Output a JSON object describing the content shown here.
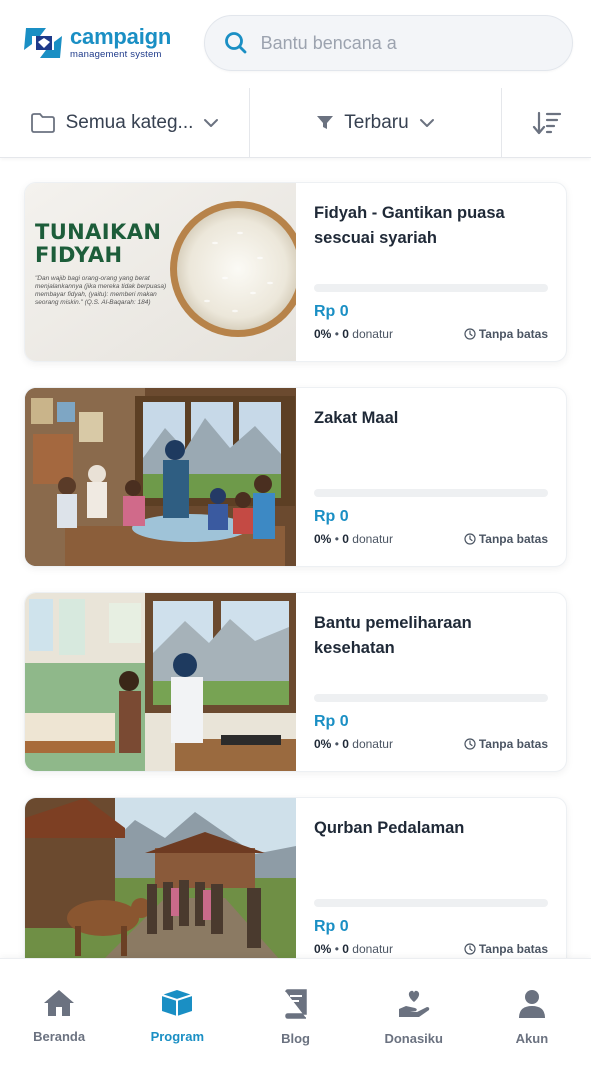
{
  "brand": {
    "title": "campaign",
    "subtitle": "management system",
    "color": "#1a8fc4"
  },
  "search": {
    "placeholder": "Bantu bencana a",
    "value": ""
  },
  "filters": {
    "category_label": "Semua kateg...",
    "sort_label": "Terbaru",
    "icons": [
      "folder-icon",
      "chevron-down-icon",
      "filter-funnel-icon",
      "sort-descending-icon"
    ]
  },
  "campaigns": [
    {
      "title": "Fidyah - Gantikan puasa sescuai syariah",
      "image_text": {
        "headline": "TUNAIKAN FIDYAH",
        "quote": "\"Dan wajib bagi orang-orang yang berat menjalankannya (jika mereka tidak berpuasa) membayar fidyah, (yaitu): memberi makan seorang miskin.\" (Q.S. Al-Baqarah: 184)"
      },
      "amount": "Rp 0",
      "progress_percent": 0,
      "percent_text": "0%",
      "separator": "•",
      "donor_count": "0",
      "donor_label": "donatur",
      "duration": "Tanpa batas"
    },
    {
      "title": "Zakat Maal",
      "amount": "Rp 0",
      "progress_percent": 0,
      "percent_text": "0%",
      "separator": "•",
      "donor_count": "0",
      "donor_label": "donatur",
      "duration": "Tanpa batas"
    },
    {
      "title": "Bantu pemeliharaan kesehatan",
      "amount": "Rp 0",
      "progress_percent": 0,
      "percent_text": "0%",
      "separator": "•",
      "donor_count": "0",
      "donor_label": "donatur",
      "duration": "Tanpa batas"
    },
    {
      "title": "Qurban Pedalaman",
      "amount": "Rp 0",
      "progress_percent": 0,
      "percent_text": "0%",
      "separator": "•",
      "donor_count": "0",
      "donor_label": "donatur",
      "duration": "Tanpa batas"
    }
  ],
  "nav": {
    "items": [
      {
        "label": "Beranda",
        "icon": "home-icon",
        "active": false
      },
      {
        "label": "Program",
        "icon": "box-icon",
        "active": true
      },
      {
        "label": "Blog",
        "icon": "book-icon",
        "active": false
      },
      {
        "label": "Donasiku",
        "icon": "hand-heart-icon",
        "active": false
      },
      {
        "label": "Akun",
        "icon": "user-icon",
        "active": false
      }
    ]
  },
  "colors": {
    "accent": "#1a8fc4",
    "text": "#1f2937",
    "muted": "#6b7280",
    "track": "#eef0f2"
  }
}
